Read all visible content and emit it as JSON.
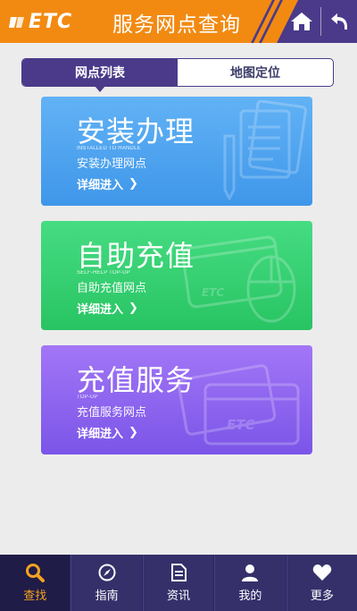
{
  "header": {
    "logo": "ETC",
    "title": "服务网点查询",
    "home_icon": "home-icon",
    "back_icon": "back-icon"
  },
  "tabs": [
    {
      "label": "网点列表",
      "active": true
    },
    {
      "label": "地图定位",
      "active": false
    }
  ],
  "cards": [
    {
      "title": "安装办理",
      "subtitle_en": "INSTALLED TO HANDLE",
      "subtitle": "安装办理网点",
      "more": "详细进入",
      "color": "#4aa3ee",
      "icon": "documents-icon"
    },
    {
      "title": "自助充值",
      "subtitle_en": "SELF-HELP TOP-UP",
      "subtitle": "自助充值网点",
      "more": "详细进入",
      "color": "#31cb6c",
      "icon": "mouse-card-icon"
    },
    {
      "title": "充值服务",
      "subtitle_en": "TOP-UP",
      "subtitle": "充值服务网点",
      "more": "详细进入",
      "color": "#8b62ee",
      "icon": "cards-icon"
    }
  ],
  "bottom_nav": [
    {
      "label": "查找",
      "icon": "search-icon",
      "active": true
    },
    {
      "label": "指南",
      "icon": "compass-icon",
      "active": false
    },
    {
      "label": "资讯",
      "icon": "document-icon",
      "active": false
    },
    {
      "label": "我的",
      "icon": "user-icon",
      "active": false
    },
    {
      "label": "更多",
      "icon": "heart-icon",
      "active": false
    }
  ],
  "colors": {
    "header": "#f28a12",
    "tab_active": "#4b3a8a",
    "nav_bg": "#35306a",
    "nav_active_text": "#f5a21f"
  }
}
